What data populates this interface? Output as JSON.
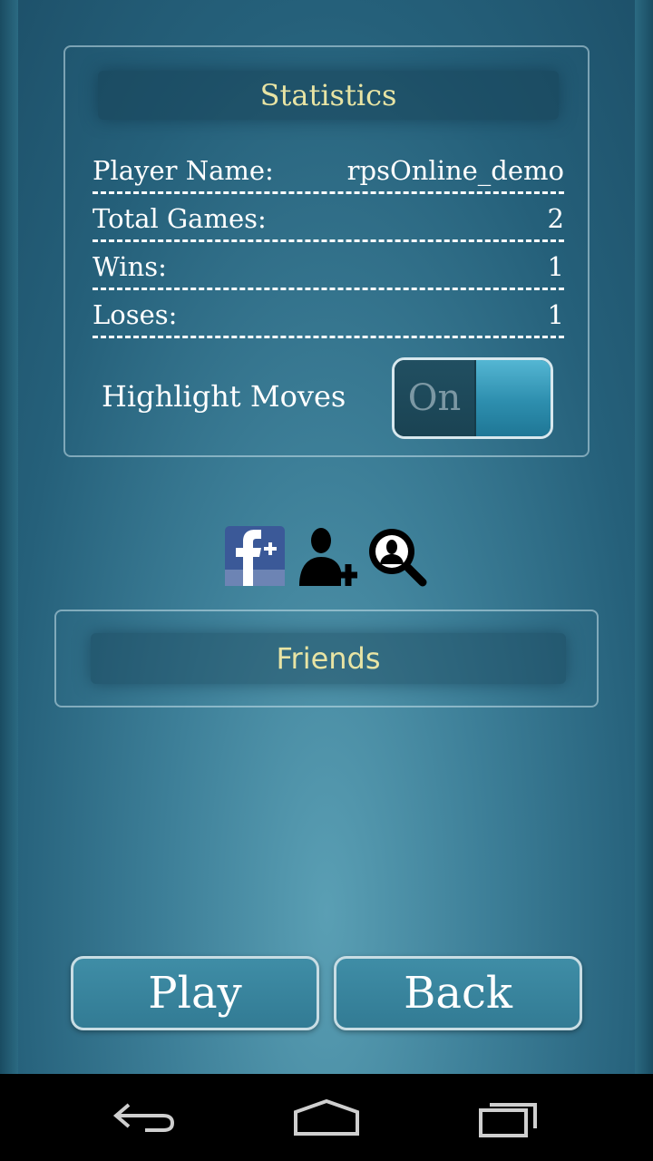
{
  "statistics": {
    "title": "Statistics",
    "rows": [
      {
        "label": "Player Name:",
        "value": "rpsOnline_demo"
      },
      {
        "label": "Total Games:",
        "value": "2"
      },
      {
        "label": "Wins:",
        "value": "1"
      },
      {
        "label": "Loses:",
        "value": "1"
      }
    ]
  },
  "highlight_moves": {
    "label": "Highlight Moves",
    "toggle_text": "On"
  },
  "social": {
    "icons": [
      "facebook-plus-icon",
      "add-friend-icon",
      "search-friend-icon"
    ]
  },
  "friends": {
    "label": "Friends"
  },
  "buttons": {
    "play": "Play",
    "back": "Back"
  },
  "nav": {
    "icons": [
      "back-icon",
      "home-icon",
      "recent-apps-icon"
    ]
  },
  "colors": {
    "accent_text": "#e8e4a4",
    "button_fill": "#3f8da6",
    "facebook_blue": "#3b5998"
  }
}
